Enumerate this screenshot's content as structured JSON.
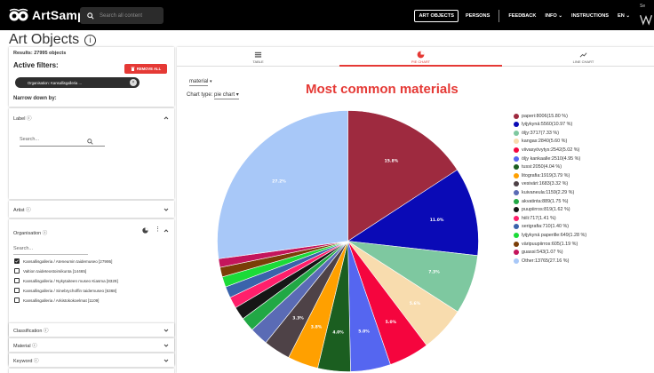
{
  "app": {
    "brand": "ArtSampo",
    "search_placeholder": "Search all content",
    "nav": {
      "art_objects": "ART OBJECTS",
      "persons": "PERSONS",
      "feedback": "FEEDBACK",
      "info": "INFO",
      "instructions": "INSTRUCTIONS",
      "lang": "EN"
    },
    "corner_text": "Se"
  },
  "page": {
    "title": "Art Objects"
  },
  "filters": {
    "results": "Results: 27995 objects",
    "active_filters": "Active filters:",
    "remove_all": "REMOVE ALL",
    "chip": "Organisation: Kansallisgalleria ...",
    "narrow": "Narrow down by:",
    "label_facet": "Label",
    "search_placeholder": "Search...",
    "artist_facet": "Artist",
    "org_facet": "Organisation",
    "org_search": "Search...",
    "org_items": [
      {
        "label": "Kansallisgalleria / Ateneumin taidemuseo [27995]",
        "checked": true
      },
      {
        "label": "Valtion taideteostoimikunta [14465]",
        "checked": false
      },
      {
        "label": "Kansallisgalleria / Nykytaiteen museo Kiasma [8329]",
        "checked": false
      },
      {
        "label": "Kansallisgalleria / Sinebrychoffin taidemuseo [6368]",
        "checked": false
      },
      {
        "label": "Kansallisgalleria / Arkistokokoelmat [1109]",
        "checked": false
      }
    ],
    "bottom_facets": [
      "Classification",
      "Material",
      "Keyword",
      "Earliest year"
    ]
  },
  "tabs": [
    {
      "label": "TABLE",
      "icon": "table-icon"
    },
    {
      "label": "PIE CHART",
      "icon": "pie-chart-icon"
    },
    {
      "label": "LINE CHART",
      "icon": "line-chart-icon"
    }
  ],
  "controls": {
    "property": "material",
    "chart_type_label": "Chart type:",
    "chart_type": "pie chart"
  },
  "chart_data": {
    "type": "pie",
    "title": "Most common materials",
    "legend_position": "right",
    "slices": [
      {
        "name": "paperi",
        "value": 8006,
        "pct": "15.80 %",
        "label": "15.8%",
        "color": "#9e2a3f"
      },
      {
        "name": "lyijykynä",
        "value": 5560,
        "pct": "10.97 %",
        "label": "11.0%",
        "color": "#0a0ab6"
      },
      {
        "name": "öljy",
        "value": 3717,
        "pct": "7.33 %",
        "label": "7.3%",
        "color": "#7ec8a0"
      },
      {
        "name": "kangas",
        "value": 2840,
        "pct": "5.60 %",
        "label": "5.6%",
        "color": "#f8dcae"
      },
      {
        "name": "viivasyövytys",
        "value": 2542,
        "pct": "5.02 %",
        "label": "5.0%",
        "color": "#f5053e"
      },
      {
        "name": "öljy kankaalle",
        "value": 2510,
        "pct": "4.95 %",
        "label": "5.0%",
        "color": "#5566f0"
      },
      {
        "name": "tussi",
        "value": 2050,
        "pct": "4.04 %",
        "label": "4.0%",
        "color": "#1b5e20"
      },
      {
        "name": "litografia",
        "value": 1919,
        "pct": "3.79 %",
        "label": "3.8%",
        "color": "#ffa000"
      },
      {
        "name": "vesiväri",
        "value": 1683,
        "pct": "3.32 %",
        "label": "3.3%",
        "color": "#4e4247"
      },
      {
        "name": "kuivaneula",
        "value": 1159,
        "pct": "2.29 %",
        "label": "",
        "color": "#5a6bb5"
      },
      {
        "name": "akvatinta",
        "value": 889,
        "pct": "1.75 %",
        "label": "",
        "color": "#21a845"
      },
      {
        "name": "puupiirros",
        "value": 819,
        "pct": "1.62 %",
        "label": "",
        "color": "#161616"
      },
      {
        "name": "hiili",
        "value": 717,
        "pct": "1.41 %",
        "label": "",
        "color": "#ff1f6b"
      },
      {
        "name": "serigrafia",
        "value": 710,
        "pct": "1.40 %",
        "label": "",
        "color": "#3a63ab"
      },
      {
        "name": "lyijykynä paperille",
        "value": 649,
        "pct": "1.28 %",
        "label": "",
        "color": "#1bdb38"
      },
      {
        "name": "väripuupiirros",
        "value": 605,
        "pct": "1.19 %",
        "label": "",
        "color": "#7b3e08"
      },
      {
        "name": "guassi",
        "value": 543,
        "pct": "1.07 %",
        "label": "",
        "color": "#c4155c"
      },
      {
        "name": "Other",
        "value": 13765,
        "pct": "27.16 %",
        "label": "27.2%",
        "color": "#a8c8f8"
      }
    ]
  }
}
